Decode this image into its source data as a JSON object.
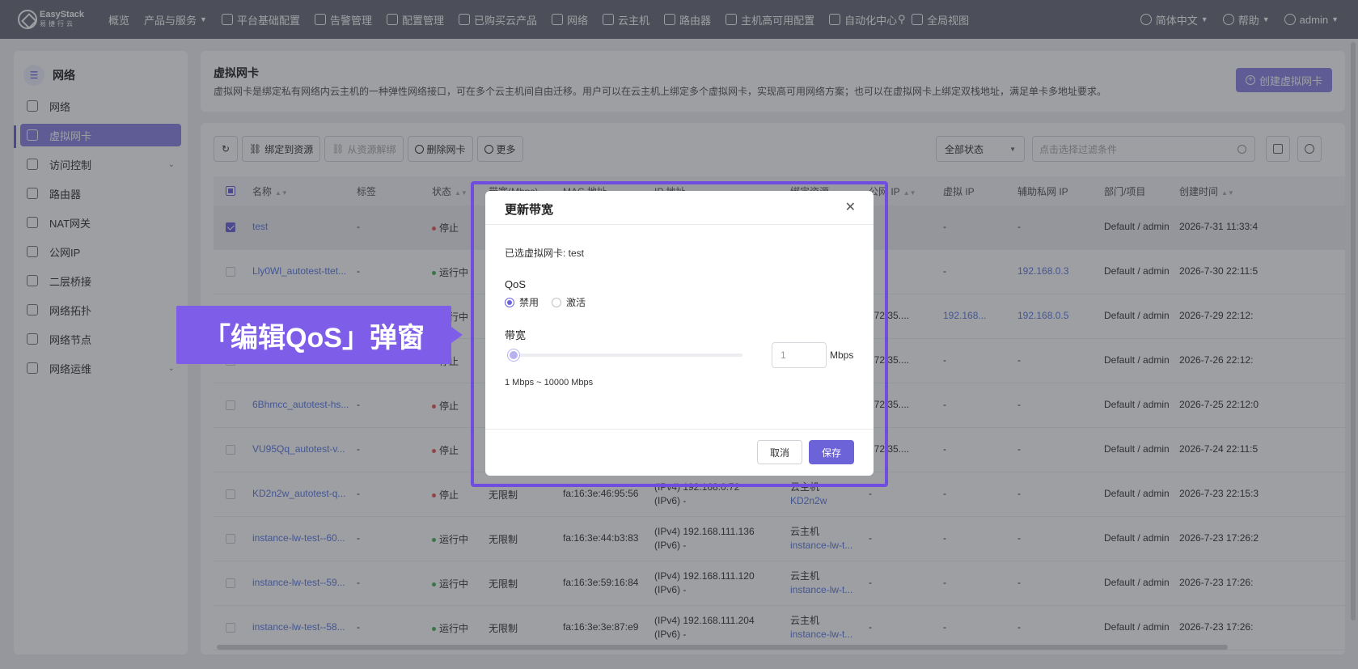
{
  "brand": {
    "name_en": "EasyStack",
    "name_cn": "易捷行云"
  },
  "topnav": {
    "items": [
      {
        "label": "概览",
        "icon": ""
      },
      {
        "label": "产品与服务",
        "icon": "",
        "dropdown": true
      },
      {
        "label": "平台基础配置",
        "icon": "gear-icon"
      },
      {
        "label": "告警管理",
        "icon": "bell-icon"
      },
      {
        "label": "配置管理",
        "icon": "gear-icon"
      },
      {
        "label": "已购买云产品",
        "icon": "list-icon"
      },
      {
        "label": "网络",
        "icon": "network-icon"
      },
      {
        "label": "云主机",
        "icon": "cloud-icon"
      },
      {
        "label": "路由器",
        "icon": "router-icon"
      },
      {
        "label": "主机高可用配置",
        "icon": "server-icon"
      },
      {
        "label": "自动化中心",
        "icon": "automation-icon"
      },
      {
        "label": "全局视图",
        "icon": "globe-icon"
      }
    ],
    "right": [
      {
        "label": "简体中文",
        "icon": "language-icon"
      },
      {
        "label": "帮助",
        "icon": "help-icon"
      },
      {
        "label": "admin",
        "icon": "user-icon"
      }
    ]
  },
  "sidebar": {
    "title": "网络",
    "items": [
      {
        "label": "网络",
        "active": false,
        "expandable": false
      },
      {
        "label": "虚拟网卡",
        "active": true,
        "expandable": false
      },
      {
        "label": "访问控制",
        "active": false,
        "expandable": true
      },
      {
        "label": "路由器",
        "active": false,
        "expandable": false
      },
      {
        "label": "NAT网关",
        "active": false,
        "expandable": false
      },
      {
        "label": "公网IP",
        "active": false,
        "expandable": false
      },
      {
        "label": "二层桥接",
        "active": false,
        "expandable": false
      },
      {
        "label": "网络拓扑",
        "active": false,
        "expandable": false
      },
      {
        "label": "网络节点",
        "active": false,
        "expandable": false
      },
      {
        "label": "网络运维",
        "active": false,
        "expandable": true
      }
    ]
  },
  "header": {
    "title": "虚拟网卡",
    "description": "虚拟网卡是绑定私有网络内云主机的一种弹性网络接口，可在多个云主机间自由迁移。用户可以在云主机上绑定多个虚拟网卡，实现高可用网络方案；也可以在虚拟网卡上绑定双栈地址，满足单卡多地址要求。",
    "create_label": "创建虚拟网卡"
  },
  "toolbar": {
    "bind_label": "绑定到资源",
    "unbind_label": "从资源解绑",
    "delete_label": "删除网卡",
    "more_label": "更多",
    "status_value": "全部状态",
    "filter_placeholder": "点击选择过滤条件"
  },
  "table": {
    "columns": [
      "名称",
      "标签",
      "状态",
      "带宽(Mbps)",
      "MAC 地址",
      "IP 地址",
      "绑定资源",
      "公网 IP",
      "虚拟 IP",
      "辅助私网 IP",
      "部门/项目",
      "创建时间"
    ],
    "rows": [
      {
        "name": "test",
        "tag": "-",
        "status": "停止",
        "status_color": "red",
        "bandwidth": "",
        "mac": "",
        "ip1": "",
        "ip2": "",
        "res1": "",
        "res2": "",
        "public_ip": "-",
        "vip": "-",
        "secondary_ip": "-",
        "dept": "Default / admin",
        "created": "2026-7-31 11:33:4",
        "selected": true
      },
      {
        "name": "Lly0Wl_autotest-ttet...",
        "tag": "-",
        "status": "运行中",
        "status_color": "green",
        "bandwidth": "",
        "mac": "",
        "ip1": "",
        "ip2": "",
        "res1": "",
        "res2": "",
        "public_ip": "-",
        "vip": "-",
        "secondary_ip": "192.168.0.3",
        "dept": "Default / admin",
        "created": "2026-7-30 22:11:5",
        "selected": false
      },
      {
        "name": "",
        "tag": "",
        "status": "运行中",
        "status_color": "green",
        "bandwidth": "",
        "mac": "",
        "ip1": "",
        "ip2": "",
        "res1": "",
        "res2": "",
        "public_ip": "172.35....",
        "vip": "192.168...",
        "secondary_ip": "192.168.0.5",
        "dept": "Default / admin",
        "created": "2026-7-29 22:12:",
        "selected": false
      },
      {
        "name": "",
        "tag": "",
        "status": "停止",
        "status_color": "red",
        "bandwidth": "",
        "mac": "",
        "ip1": "",
        "ip2": "",
        "res1": "",
        "res2": "",
        "public_ip": "172.35....",
        "vip": "-",
        "secondary_ip": "-",
        "dept": "Default / admin",
        "created": "2026-7-26 22:12:",
        "selected": false
      },
      {
        "name": "6Bhmcc_autotest-hs...",
        "tag": "-",
        "status": "停止",
        "status_color": "red",
        "bandwidth": "",
        "mac": "",
        "ip1": "",
        "ip2": "",
        "res1": "",
        "res2": "",
        "public_ip": "172.35....",
        "vip": "-",
        "secondary_ip": "-",
        "dept": "Default / admin",
        "created": "2026-7-25 22:12:0",
        "selected": false
      },
      {
        "name": "VU95Qq_autotest-v...",
        "tag": "-",
        "status": "停止",
        "status_color": "red",
        "bandwidth": "",
        "mac": "",
        "ip1": "",
        "ip2": "",
        "res1": "",
        "res2": "",
        "public_ip": "172.35....",
        "vip": "-",
        "secondary_ip": "-",
        "dept": "Default / admin",
        "created": "2026-7-24 22:11:5",
        "selected": false
      },
      {
        "name": "KD2n2w_autotest-q...",
        "tag": "-",
        "status": "停止",
        "status_color": "red",
        "bandwidth": "无限制",
        "mac": "fa:16:3e:46:95:56",
        "ip1": "(IPv4) 192.168.0.72",
        "ip2": "(IPv6) -",
        "res1": "云主机",
        "res2": "KD2n2w",
        "public_ip": "-",
        "vip": "-",
        "secondary_ip": "-",
        "dept": "Default / admin",
        "created": "2026-7-23 22:15:3",
        "selected": false
      },
      {
        "name": "instance-lw-test--60...",
        "tag": "-",
        "status": "运行中",
        "status_color": "green",
        "bandwidth": "无限制",
        "mac": "fa:16:3e:44:b3:83",
        "ip1": "(IPv4) 192.168.111.136",
        "ip2": "(IPv6) -",
        "res1": "云主机",
        "res2": "instance-lw-t...",
        "public_ip": "-",
        "vip": "-",
        "secondary_ip": "-",
        "dept": "Default / admin",
        "created": "2026-7-23 17:26:2",
        "selected": false
      },
      {
        "name": "instance-lw-test--59...",
        "tag": "-",
        "status": "运行中",
        "status_color": "green",
        "bandwidth": "无限制",
        "mac": "fa:16:3e:59:16:84",
        "ip1": "(IPv4) 192.168.111.120",
        "ip2": "(IPv6) -",
        "res1": "云主机",
        "res2": "instance-lw-t...",
        "public_ip": "-",
        "vip": "-",
        "secondary_ip": "-",
        "dept": "Default / admin",
        "created": "2026-7-23 17:26:",
        "selected": false
      },
      {
        "name": "instance-lw-test--58...",
        "tag": "-",
        "status": "运行中",
        "status_color": "green",
        "bandwidth": "无限制",
        "mac": "fa:16:3e:3e:87:e9",
        "ip1": "(IPv4) 192.168.111.204",
        "ip2": "(IPv6) -",
        "res1": "云主机",
        "res2": "instance-lw-t...",
        "public_ip": "-",
        "vip": "-",
        "secondary_ip": "-",
        "dept": "Default / admin",
        "created": "2026-7-23 17:26:",
        "selected": false
      }
    ]
  },
  "modal": {
    "title": "更新带宽",
    "selected_text": "已选虚拟网卡: test",
    "qos_label": "QoS",
    "qos_options": [
      "禁用",
      "激活"
    ],
    "qos_selected": "禁用",
    "bandwidth_label": "带宽",
    "bandwidth_value": "1",
    "bandwidth_unit": "Mbps",
    "bandwidth_range": "1 Mbps ~ 10000 Mbps",
    "slider_level": 0,
    "cancel_label": "取消",
    "save_label": "保存"
  },
  "callout": {
    "text": "「编辑QoS」弹窗"
  },
  "colors": {
    "accent": "#6c63d9",
    "callout": "#7e5ee8",
    "topbar": "#6b6e78"
  }
}
